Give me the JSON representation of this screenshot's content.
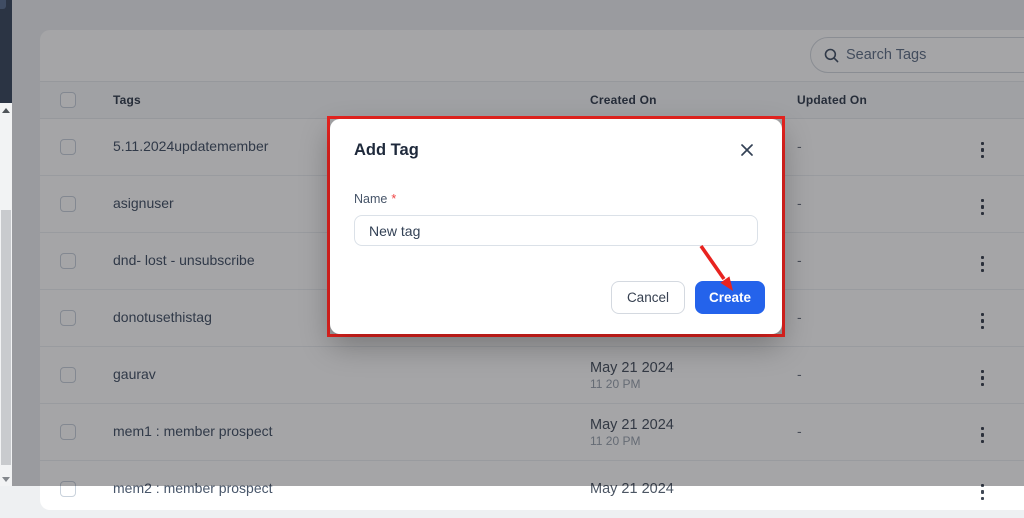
{
  "search": {
    "placeholder": "Search Tags"
  },
  "table": {
    "columns": [
      "Tags",
      "Created On",
      "Updated On"
    ],
    "rows": [
      {
        "name": "5.11.2024updatemember",
        "created_date": "",
        "created_time": "",
        "updated": "-"
      },
      {
        "name": "asignuser",
        "created_date": "",
        "created_time": "",
        "updated": "-"
      },
      {
        "name": "dnd- lost - unsubscribe",
        "created_date": "",
        "created_time": "",
        "updated": "-"
      },
      {
        "name": "donotusethistag",
        "created_date": "",
        "created_time": "",
        "updated": "-"
      },
      {
        "name": "gaurav",
        "created_date": "May 21 2024",
        "created_time": "11 20 PM",
        "updated": "-"
      },
      {
        "name": "mem1 : member prospect",
        "created_date": "May 21 2024",
        "created_time": "11 20 PM",
        "updated": "-"
      },
      {
        "name": "mem2 : member prospect",
        "created_date": "May 21 2024",
        "created_time": "",
        "updated": "",
        "partially_visible": true
      }
    ]
  },
  "modal": {
    "title": "Add Tag",
    "name_label": "Name",
    "required_mark": "*",
    "input_value": "New tag",
    "cancel_label": "Cancel",
    "create_label": "Create",
    "accent_color": "#2463eb"
  },
  "annotation": {
    "highlight_color": "#e8231f"
  }
}
